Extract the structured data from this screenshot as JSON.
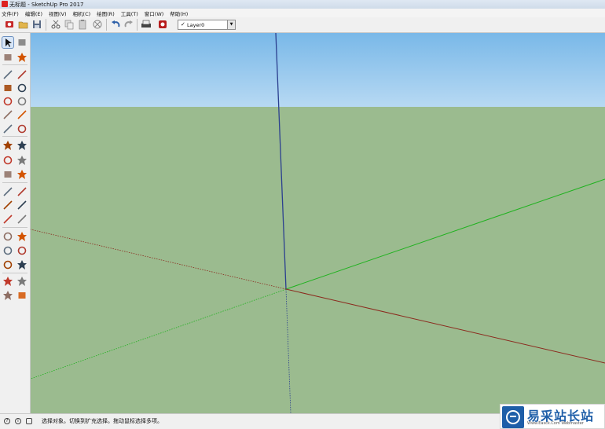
{
  "window": {
    "title": "无标题 - SketchUp Pro 2017"
  },
  "menu": [
    {
      "label": "文件(F)"
    },
    {
      "label": "编辑(E)"
    },
    {
      "label": "视图(V)"
    },
    {
      "label": "相机(C)"
    },
    {
      "label": "绘图(R)"
    },
    {
      "label": "工具(T)"
    },
    {
      "label": "窗口(W)"
    },
    {
      "label": "帮助(H)"
    }
  ],
  "toolbar": {
    "icons": [
      "getting-started-icon",
      "open-icon",
      "save-icon",
      "cut-icon",
      "copy-icon",
      "paste-icon",
      "erase-icon",
      "undo-icon",
      "redo-icon",
      "print-icon",
      "model-info-icon"
    ],
    "layer": {
      "check": "✓",
      "label": "Layer0",
      "arrow": "▼"
    }
  },
  "left_tools": [
    [
      "select-icon",
      "make-component-icon"
    ],
    [
      "paint-bucket-icon",
      "eraser-icon"
    ],
    [
      "line-icon",
      "freehand-icon"
    ],
    [
      "rectangle-icon",
      "rotated-rectangle-icon"
    ],
    [
      "circle-icon",
      "polygon-icon"
    ],
    [
      "arc-icon",
      "two-point-arc-icon"
    ],
    [
      "three-point-arc-icon",
      "pie-icon"
    ],
    [
      "move-icon",
      "push-pull-icon"
    ],
    [
      "rotate-icon",
      "follow-me-icon"
    ],
    [
      "scale-icon",
      "offset-icon"
    ],
    [
      "tape-measure-icon",
      "dimension-icon"
    ],
    [
      "protractor-icon",
      "text-icon"
    ],
    [
      "axes-icon",
      "3d-text-icon"
    ],
    [
      "orbit-icon",
      "pan-icon"
    ],
    [
      "zoom-icon",
      "zoom-window-icon"
    ],
    [
      "zoom-extents-icon",
      "previous-view-icon"
    ],
    [
      "position-camera-icon",
      "look-around-icon"
    ],
    [
      "walk-icon",
      "section-plane-icon"
    ]
  ],
  "colors": {
    "sky_top": "#79b8e8",
    "sky_bottom": "#b7d9f3",
    "ground": "#9bbb8f",
    "axis_blue": "#2b3f8f",
    "axis_green": "#1fb21f",
    "axis_red": "#8b2a1e"
  },
  "statusbar": {
    "icons": [
      "help-icon",
      "info-icon",
      "user-icon"
    ],
    "text": "选择对象。切换到扩充选择。拖动鼠标选择多项。"
  },
  "watermark": {
    "title": "易采站长站",
    "subtitle": "Www.Easck.Com  Webmaster"
  }
}
